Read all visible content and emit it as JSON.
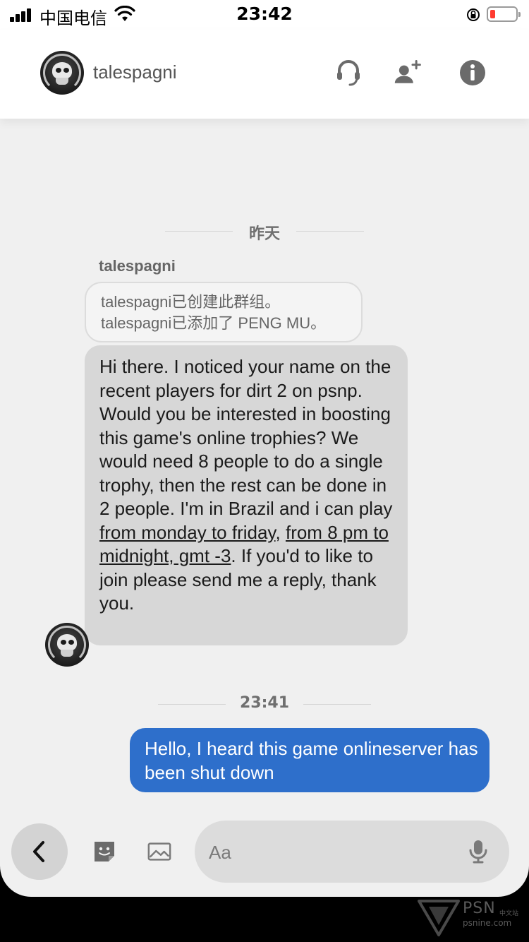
{
  "status_bar": {
    "carrier": "中国电信",
    "time": "23:42"
  },
  "header": {
    "name": "talespagni",
    "icons": [
      "headset-icon",
      "add-user-icon",
      "info-icon"
    ]
  },
  "conversation": {
    "day_divider": "昨天",
    "sender_name": "talespagni",
    "system_lines": [
      "talespagni已创建此群组。",
      "talespagni已添加了 PENG MU。"
    ],
    "incoming": {
      "text_before": "Hi there. I noticed your name on the recent players for dirt 2 on psnp. Would you be interested in boosting this game's online trophies? We would need 8 people to do a single trophy, then the rest can be done in 2 people. I'm in Brazil and i can play ",
      "link1": "from monday to friday",
      "sep": ", ",
      "link2": "from 8 pm to midnight, gmt -3",
      "text_after": ". If you'd to like to join please send me a reply, thank you."
    },
    "time_divider": "23:41",
    "outgoing": {
      "text": "Hello, I heard this game onlineserver has been shut down"
    }
  },
  "composer": {
    "placeholder": "Aa"
  },
  "watermark": {
    "brand": "PSN",
    "cn": "中文站",
    "url": "psnine.com"
  },
  "colors": {
    "outgoing_bubble": "#2e6fcb",
    "incoming_bubble": "#d7d7d7",
    "background": "#f0f0f0",
    "battery_low": "#ff3b30"
  }
}
